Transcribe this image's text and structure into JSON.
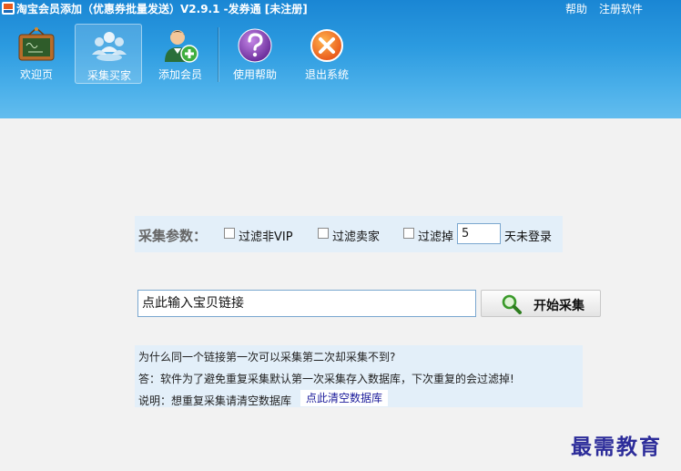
{
  "window": {
    "title": "淘宝会员添加（优惠券批量发送）V2.9.1 -发券通 [未注册]",
    "help_link": "帮助",
    "register_link": "注册软件"
  },
  "toolbar": {
    "items": [
      {
        "label": "欢迎页",
        "icon": "blackboard-icon",
        "active": false
      },
      {
        "label": "采集买家",
        "icon": "people-group-icon",
        "active": true
      },
      {
        "label": "添加会员",
        "icon": "add-user-icon",
        "active": false
      },
      {
        "label": "使用帮助",
        "icon": "question-icon",
        "active": false
      },
      {
        "label": "退出系统",
        "icon": "close-circle-icon",
        "active": false
      }
    ]
  },
  "params": {
    "label": "采集参数：",
    "filter_vip": {
      "label": "过滤非VIP",
      "checked": false
    },
    "filter_seller": {
      "label": "过滤卖家",
      "checked": false
    },
    "filter_inactive": {
      "label": "过滤掉",
      "checked": false
    },
    "days_value": "5",
    "days_suffix": "天未登录"
  },
  "search": {
    "link_placeholder": "点此输入宝贝链接",
    "start_button": "开始采集",
    "start_icon": "magnifier-icon"
  },
  "info": {
    "question": "为什么同一个链接第一次可以采集第二次却采集不到?",
    "answer": "答：软件为了避免重复采集默认第一次采集存入数据库，下次重复的会过滤掉!",
    "note": "说明：想重复采集请清空数据库",
    "clear_db": "点此清空数据库"
  },
  "watermark": "最需教育",
  "colors": {
    "header_top": "#1a86d4",
    "header_bottom": "#63bdee",
    "panel_bg": "#e3eff9",
    "watermark": "#2d2d9a"
  }
}
